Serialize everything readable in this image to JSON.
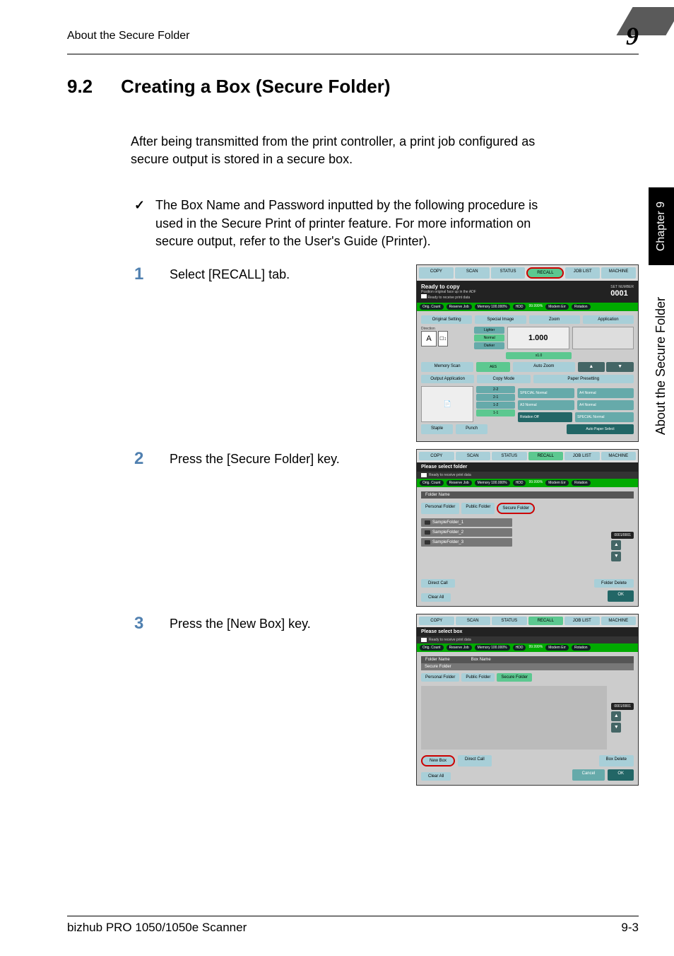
{
  "header": {
    "title": "About the Secure Folder",
    "chapter": "9"
  },
  "section": {
    "num": "9.2",
    "title": "Creating a Box (Secure Folder)"
  },
  "intro": "After being transmitted from the print controller, a print job configured as secure output is stored in a secure box.",
  "check": "The Box Name and Password inputted by the following procedure is used in the Secure Print of printer feature. For more information on secure output, refer to the User's Guide (Printer).",
  "steps": [
    {
      "num": "1",
      "text": "Select [RECALL] tab."
    },
    {
      "num": "2",
      "text": "Press the [Secure Folder] key."
    },
    {
      "num": "3",
      "text": "Press the [New Box] key."
    }
  ],
  "screen1": {
    "tabs": [
      "COPY",
      "SCAN",
      "STATUS",
      "RECALL",
      "JOB LIST",
      "MACHINE"
    ],
    "status_ready": "Ready to copy",
    "status_sub": "Position original face up in the ADF",
    "status_sub2": "Ready to receive print data",
    "counter_label": "SET NUMBER",
    "counter": "0001",
    "bar_items": [
      "Orig. Count",
      "Reserve Job",
      "Memory 100.000%",
      "HDD",
      "99.999%",
      "Modem Err",
      "Rotation"
    ],
    "row1": [
      "Original Setting",
      "Special Image",
      "Zoom",
      "Application"
    ],
    "direction_label": "Direction",
    "direction_a": "A",
    "density": [
      "Lighter",
      "Normal",
      "Darker"
    ],
    "zoom_val": "1.000",
    "zoom_x1": "x1.0",
    "memory_scan": "Memory Scan",
    "aes": "AES",
    "auto_zoom": "Auto Zoom",
    "row3": [
      "Output Application",
      "Copy Mode"
    ],
    "paper_presetting": "Paper Presetting",
    "modes": [
      "2-2",
      "2-1",
      "1-2",
      "1-1"
    ],
    "trays": [
      "SPECIAL Normal",
      "A4 Normal",
      "A3 Normal",
      "A4 Normal",
      "SPECIAL Normal"
    ],
    "staple": "Staple",
    "punch": "Punch",
    "rotation_off": "Rotation Off",
    "auto_paper": "Auto Paper Select"
  },
  "screen2": {
    "select_header": "Please select folder",
    "subhead": "Ready to receive print data",
    "folder_name_label": "Folder Name",
    "tabs": [
      "Personal Folder",
      "Public Folder",
      "Secure Folder"
    ],
    "items": [
      "SampleFolder_1",
      "SampleFolder_2",
      "SampleFolder_3"
    ],
    "pager": "0001/0001",
    "direct_call": "Direct Call",
    "folder_delete": "Folder Delete",
    "clear_all": "Clear All",
    "ok": "OK"
  },
  "screen3": {
    "select_header": "Please select box",
    "subhead": "Ready to receive print data",
    "folder_name_label": "Folder Name",
    "box_name_label": "Box Name",
    "secure_folder": "Secure Folder",
    "tabs": [
      "Personal Folder",
      "Public Folder",
      "Secure Folder"
    ],
    "pager": "0001/0001",
    "new_box": "New Box",
    "direct_call": "Direct Call",
    "box_delete": "Box Delete",
    "clear_all": "Clear All",
    "cancel": "Cancel",
    "ok": "OK"
  },
  "side": {
    "chapter": "Chapter 9",
    "title": "About the Secure Folder"
  },
  "footer": {
    "left": "bizhub PRO 1050/1050e Scanner",
    "right": "9-3"
  }
}
